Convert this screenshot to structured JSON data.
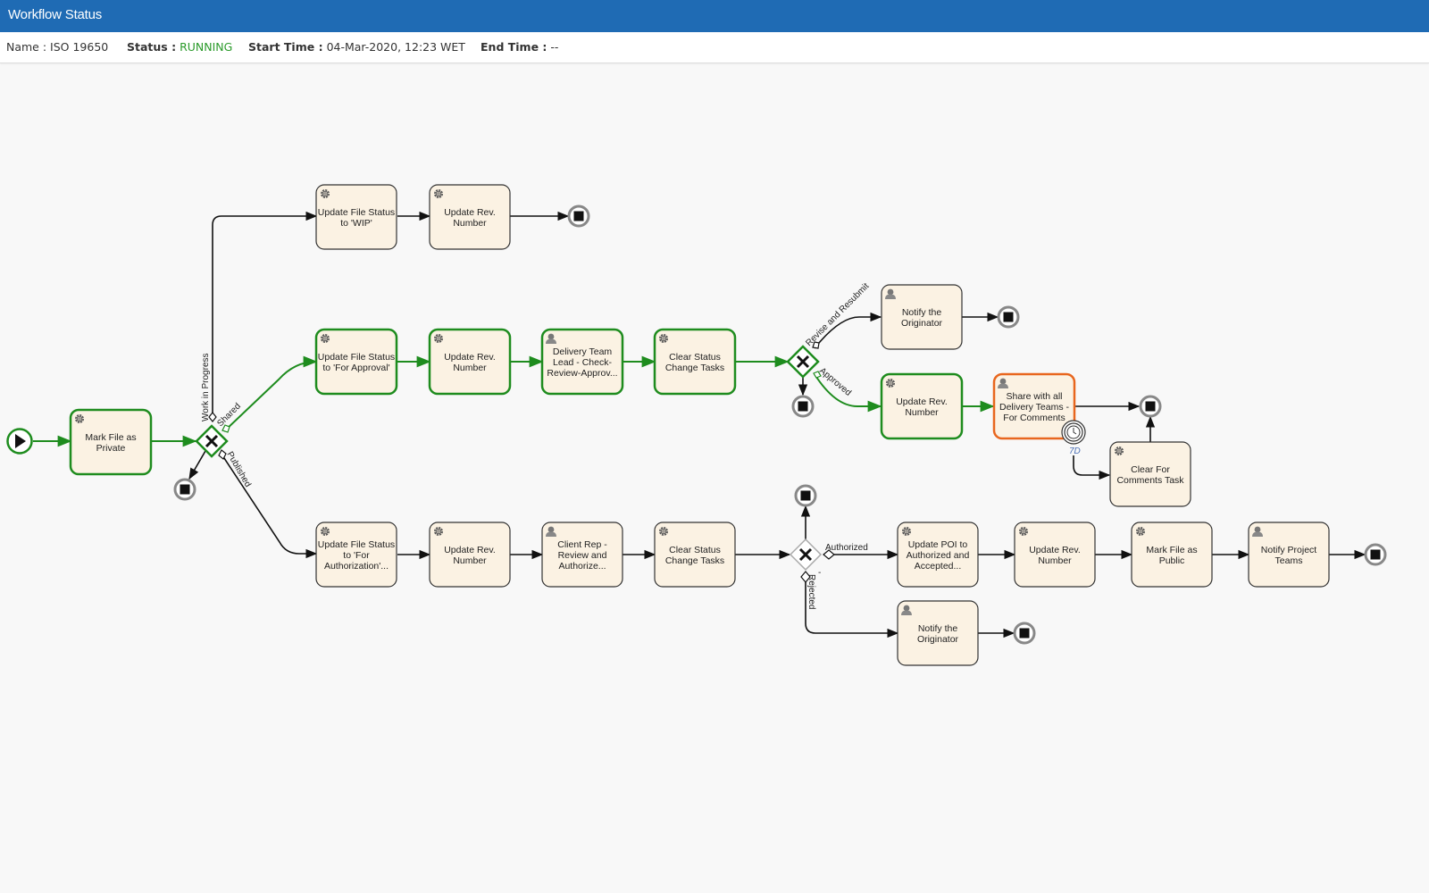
{
  "window": {
    "title": "Workflow Status"
  },
  "info": {
    "name_label": "Name :",
    "name_value": "ISO 19650",
    "status_label": "Status :",
    "status_value": "RUNNING",
    "start_label": "Start Time :",
    "start_value": "04-Mar-2020, 12:23 WET",
    "end_label": "End Time :",
    "end_value": "--"
  },
  "colors": {
    "header": "#1f6bb4",
    "active_green": "#1e8c1e",
    "current_orange": "#e8661e",
    "task_fill": "#fbf2e3",
    "neutral_stroke": "#333333",
    "status_running": "#2a9a2a"
  },
  "diagram": {
    "tasks": [
      {
        "id": "t_private",
        "lines": [
          "Mark File as",
          "Private"
        ],
        "icon": "gear-icon",
        "state": "completed"
      },
      {
        "id": "t_wip_status",
        "lines": [
          "Update File Status",
          "to 'WIP'"
        ],
        "icon": "gear-icon",
        "state": "pending"
      },
      {
        "id": "t_wip_rev",
        "lines": [
          "Update Rev.",
          "Number"
        ],
        "icon": "gear-icon",
        "state": "pending"
      },
      {
        "id": "t_appr_status",
        "lines": [
          "Update File Status",
          "to 'For Approval'"
        ],
        "icon": "gear-icon",
        "state": "completed"
      },
      {
        "id": "t_appr_rev",
        "lines": [
          "Update Rev.",
          "Number"
        ],
        "icon": "gear-icon",
        "state": "completed"
      },
      {
        "id": "t_dtl",
        "lines": [
          "Delivery Team",
          "Lead - Check-",
          "Review-Approv..."
        ],
        "icon": "user-icon",
        "state": "completed"
      },
      {
        "id": "t_clear1",
        "lines": [
          "Clear Status",
          "Change Tasks"
        ],
        "icon": "gear-icon",
        "state": "completed"
      },
      {
        "id": "t_notify1",
        "lines": [
          "Notify the",
          "Originator"
        ],
        "icon": "user-icon",
        "state": "pending"
      },
      {
        "id": "t_rev2",
        "lines": [
          "Update Rev.",
          "Number"
        ],
        "icon": "gear-icon",
        "state": "completed"
      },
      {
        "id": "t_share",
        "lines": [
          "Share with all",
          "Delivery Teams -",
          "For Comments"
        ],
        "icon": "user-icon",
        "state": "active"
      },
      {
        "id": "t_clearcomments",
        "lines": [
          "Clear For",
          "Comments Task"
        ],
        "icon": "gear-icon",
        "state": "pending"
      },
      {
        "id": "t_auth_status",
        "lines": [
          "Update File Status",
          "to 'For",
          "Authorization'..."
        ],
        "icon": "gear-icon",
        "state": "pending"
      },
      {
        "id": "t_auth_rev",
        "lines": [
          "Update Rev.",
          "Number"
        ],
        "icon": "gear-icon",
        "state": "pending"
      },
      {
        "id": "t_client",
        "lines": [
          "Client Rep -",
          "Review and",
          "Authorize..."
        ],
        "icon": "user-icon",
        "state": "pending"
      },
      {
        "id": "t_clear2",
        "lines": [
          "Clear Status",
          "Change Tasks"
        ],
        "icon": "gear-icon",
        "state": "pending"
      },
      {
        "id": "t_poi",
        "lines": [
          "Update POI to",
          "Authorized and",
          "Accepted..."
        ],
        "icon": "gear-icon",
        "state": "pending"
      },
      {
        "id": "t_pub_rev",
        "lines": [
          "Update Rev.",
          "Number"
        ],
        "icon": "gear-icon",
        "state": "pending"
      },
      {
        "id": "t_public",
        "lines": [
          "Mark File as",
          "Public"
        ],
        "icon": "gear-icon",
        "state": "pending"
      },
      {
        "id": "t_notify_teams",
        "lines": [
          "Notify Project",
          "Teams"
        ],
        "icon": "user-icon",
        "state": "pending"
      },
      {
        "id": "t_notify2",
        "lines": [
          "Notify the",
          "Originator"
        ],
        "icon": "user-icon",
        "state": "pending"
      }
    ],
    "edge_labels": {
      "wip": "Work in Progress",
      "shared": "Shared",
      "published": "Published",
      "revise": "Revise and Resubmit",
      "approved": "Approved",
      "authorized": "Authorized",
      "rejected": "Rejected",
      "dash": "-"
    },
    "timer_label": "7D"
  }
}
